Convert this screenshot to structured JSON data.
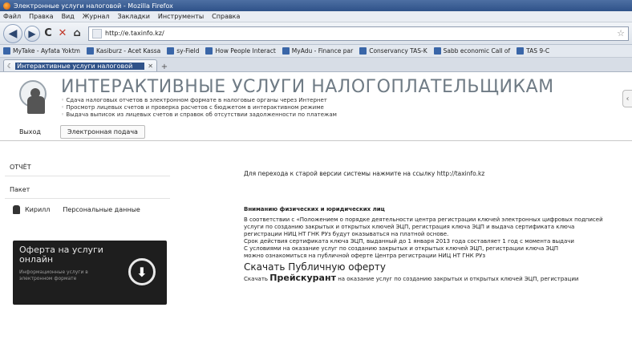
{
  "window": {
    "title": "Электронные услуги налоговой - Mozilla Firefox"
  },
  "menu": [
    "Файл",
    "Правка",
    "Вид",
    "Журнал",
    "Закладки",
    "Инструменты",
    "Справка"
  ],
  "nav": {
    "url": "http://e.taxinfo.kz/"
  },
  "bookmarks": [
    "MyTake - Ayfata Yoktm",
    "Kasiburz - Acet Kassa",
    "sy-Field",
    "How People Interact",
    "MyAdu - Finance par",
    "Conservancy TAS-K",
    "Sabb economic Call of",
    "TAS 9-C"
  ],
  "tab": {
    "label": "Интерактивные услуги налоговой"
  },
  "banner": {
    "title": "ИНТЕРАКТИВНЫЕ УСЛУГИ НАЛОГОПЛАТЕЛЬЩИКАМ",
    "lines": [
      "Сдача налоговых отчетов в электронном формате в налоговые органы через Интернет",
      "Просмотр лицевых счетов и проверка расчетов с бюджетом в интерактивном режиме",
      "Выдача выписок из лицевых счетов и справок об отсутствии задолженности по платежам"
    ]
  },
  "subnav": {
    "login": "Выход",
    "tab_label": "Электронная подача"
  },
  "left": {
    "items": [
      "ОТЧЁТ",
      "Пакет"
    ],
    "user_name": "Кирилл",
    "user_link": "Персональные данные"
  },
  "promo": {
    "title": "Оферта на услуги онлайн",
    "sub": "Информационные услуги в электронном формате"
  },
  "main": {
    "notice": "Для перехода к старой версии системы нажмите на ссылку http://taxinfo.kz",
    "attention_head": "Вниманию физических и юридических лиц",
    "paragraph": [
      "В соответствии с «Положением о порядке деятельности центра регистрации ключей электронных цифровых подписей",
      "услуги по созданию закрытых и открытых ключей ЭЦП, регистрация ключа ЭЦП и выдача сертификата ключа",
      "регистрации НИЦ НТ ГНК РУз будут оказываться на платной основе.",
      "Срок действия сертификата ключа ЭЦП, выданный до 1 января 2013 года составляет 1 год с момента выдачи",
      "С условиями на оказание услуг по созданию закрытых и открытых ключей ЭЦП, регистрации ключа ЭЦП",
      "можно ознакомиться на публичной оферте Центра регистрации НИЦ НТ ГНК РУз"
    ],
    "download_link": "Скачать Публичную оферту",
    "last_line_prefix": "Скачать",
    "last_line_bold": "Прейскурант",
    "last_line_rest": "на оказание услуг по созданию закрытых и открытых ключей ЭЦП, регистрации"
  }
}
